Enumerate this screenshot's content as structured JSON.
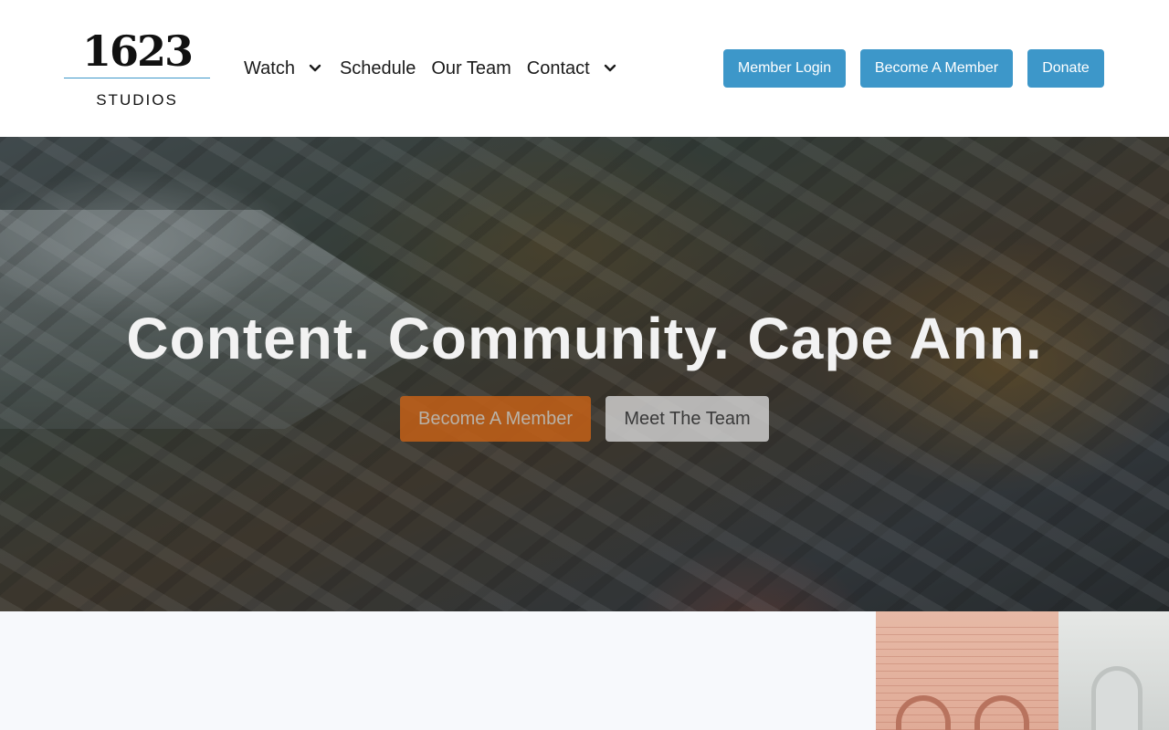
{
  "header": {
    "logo": {
      "number": "1623",
      "subtitle": "STUDIOS"
    },
    "nav": {
      "watch": "Watch",
      "schedule": "Schedule",
      "our_team": "Our Team",
      "contact": "Contact"
    },
    "buttons": {
      "member_login": "Member Login",
      "become_member": "Become A Member",
      "donate": "Donate"
    }
  },
  "hero": {
    "title": "Content. Community. Cape Ann.",
    "cta_member": "Become A Member",
    "cta_team": "Meet The Team"
  },
  "colors": {
    "accent": "#3d97c9",
    "cta_orange": "#c46018",
    "cta_gray": "#d7d7d7",
    "section_bg": "#f7f9fc"
  },
  "icons": {
    "watch_dropdown": "chevron-down-icon",
    "contact_dropdown": "chevron-down-icon"
  }
}
